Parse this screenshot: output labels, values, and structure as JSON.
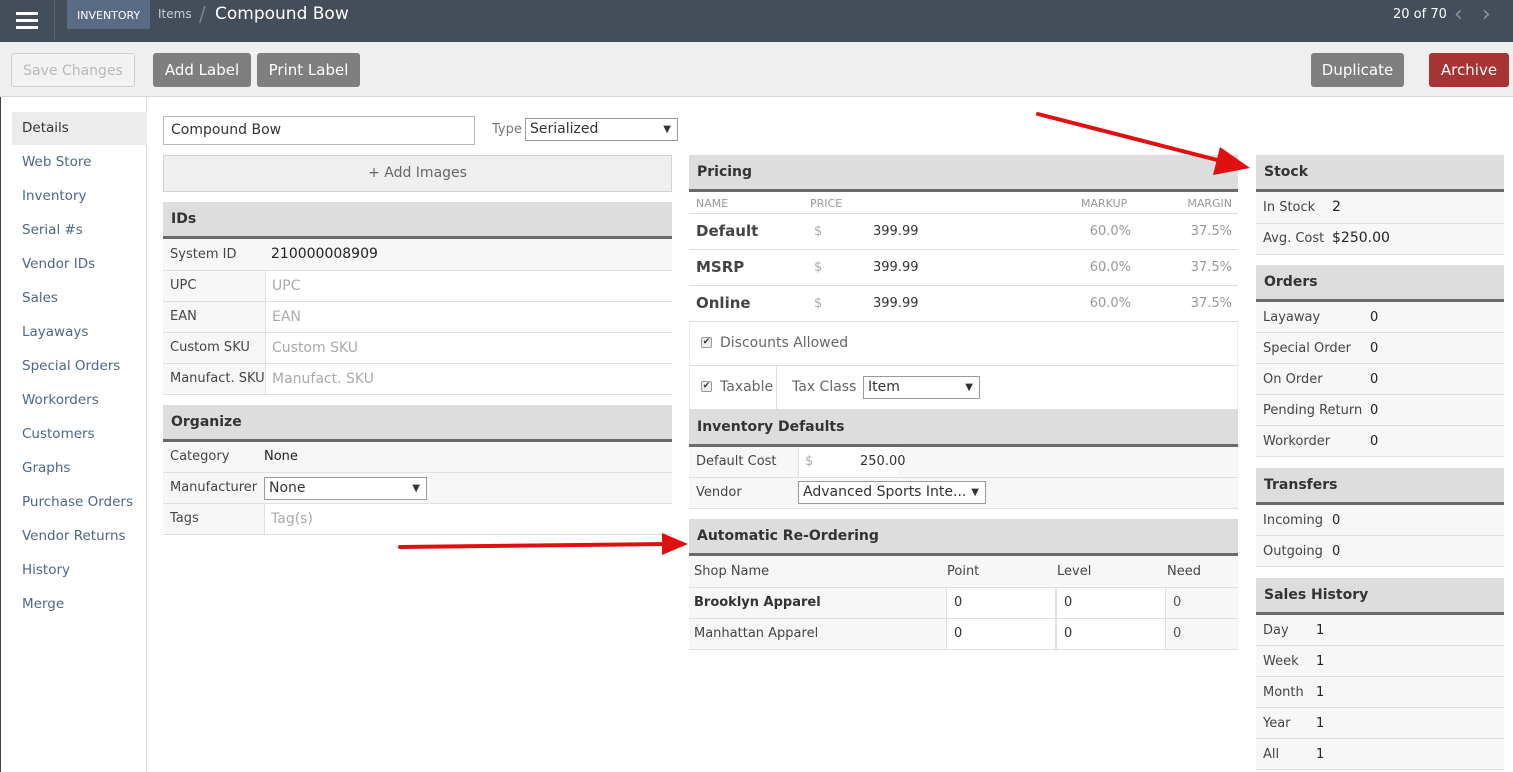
{
  "topbar": {
    "section": "INVENTORY",
    "breadcrumb_parent": "Items",
    "breadcrumb_separator": "/",
    "title": "Compound Bow",
    "pager": "20 of 70",
    "prev_icon": "‹",
    "next_icon": "›"
  },
  "toolbar": {
    "save_label": "Save Changes",
    "add_label": "Add Label",
    "print_label": "Print Label",
    "duplicate_label": "Duplicate",
    "archive_label": "Archive"
  },
  "sidebar": {
    "items": [
      {
        "label": "Details",
        "active": true
      },
      {
        "label": "Web Store"
      },
      {
        "label": "Inventory"
      },
      {
        "label": "Serial #s"
      },
      {
        "label": "Vendor IDs"
      },
      {
        "label": "Sales"
      },
      {
        "label": "Layaways"
      },
      {
        "label": "Special Orders"
      },
      {
        "label": "Workorders"
      },
      {
        "label": "Customers"
      },
      {
        "label": "Graphs"
      },
      {
        "label": "Purchase Orders"
      },
      {
        "label": "Vendor Returns"
      },
      {
        "label": "History"
      },
      {
        "label": "Merge"
      }
    ]
  },
  "item": {
    "name": "Compound Bow",
    "type_label": "Type",
    "type_value": "Serialized",
    "add_images": "+ Add Images"
  },
  "ids": {
    "title": "IDs",
    "system_id_label": "System ID",
    "system_id": "210000008909",
    "fields": [
      {
        "label": "UPC",
        "placeholder": "UPC"
      },
      {
        "label": "EAN",
        "placeholder": "EAN"
      },
      {
        "label": "Custom SKU",
        "placeholder": "Custom SKU"
      },
      {
        "label": "Manufact. SKU",
        "placeholder": "Manufact. SKU"
      }
    ]
  },
  "organize": {
    "title": "Organize",
    "category_label": "Category",
    "category_value": "None",
    "manufacturer_label": "Manufacturer",
    "manufacturer_value": "None",
    "tags_label": "Tags",
    "tags_placeholder": "Tag(s)"
  },
  "pricing": {
    "title": "Pricing",
    "columns": {
      "name": "NAME",
      "price": "PRICE",
      "markup": "MARKUP",
      "margin": "MARGIN"
    },
    "rows": [
      {
        "name": "Default",
        "currency": "$",
        "price": "399.99",
        "markup": "60.0%",
        "margin": "37.5%"
      },
      {
        "name": "MSRP",
        "currency": "$",
        "price": "399.99",
        "markup": "60.0%",
        "margin": "37.5%"
      },
      {
        "name": "Online",
        "currency": "$",
        "price": "399.99",
        "markup": "60.0%",
        "margin": "37.5%"
      }
    ],
    "discounts_label": "Discounts Allowed",
    "discounts_checked": true,
    "taxable_label": "Taxable",
    "taxable_checked": true,
    "tax_class_label": "Tax Class",
    "tax_class_value": "Item"
  },
  "inventory_defaults": {
    "title": "Inventory Defaults",
    "default_cost_label": "Default Cost",
    "currency": "$",
    "default_cost": "250.00",
    "vendor_label": "Vendor",
    "vendor_value": "Advanced Sports Inte..."
  },
  "reorder": {
    "title": "Automatic Re-Ordering",
    "columns": {
      "shop": "Shop Name",
      "point": "Point",
      "level": "Level",
      "need": "Need"
    },
    "rows": [
      {
        "shop": "Brooklyn Apparel",
        "point": "0",
        "level": "0",
        "need": "0"
      },
      {
        "shop": "Manhattan Apparel",
        "point": "0",
        "level": "0",
        "need": "0"
      }
    ]
  },
  "stock": {
    "title": "Stock",
    "in_stock_label": "In Stock",
    "in_stock": "2",
    "avg_cost_label": "Avg. Cost",
    "avg_cost": "$250.00"
  },
  "orders": {
    "title": "Orders",
    "rows": [
      {
        "label": "Layaway",
        "value": "0"
      },
      {
        "label": "Special Order",
        "value": "0"
      },
      {
        "label": "On Order",
        "value": "0"
      },
      {
        "label": "Pending Return",
        "value": "0"
      },
      {
        "label": "Workorder",
        "value": "0"
      }
    ]
  },
  "transfers": {
    "title": "Transfers",
    "rows": [
      {
        "label": "Incoming",
        "value": "0"
      },
      {
        "label": "Outgoing",
        "value": "0"
      }
    ]
  },
  "sales_history": {
    "title": "Sales History",
    "rows": [
      {
        "label": "Day",
        "value": "1"
      },
      {
        "label": "Week",
        "value": "1"
      },
      {
        "label": "Month",
        "value": "1"
      },
      {
        "label": "Year",
        "value": "1"
      },
      {
        "label": "All",
        "value": "1"
      }
    ]
  },
  "colors": {
    "topbar": "#444e5a",
    "section_badge": "#5a6b84",
    "archive": "#a73333",
    "gray_button": "#7f7f7f",
    "link": "#4d6788",
    "annotation_arrow": "#e01010"
  }
}
